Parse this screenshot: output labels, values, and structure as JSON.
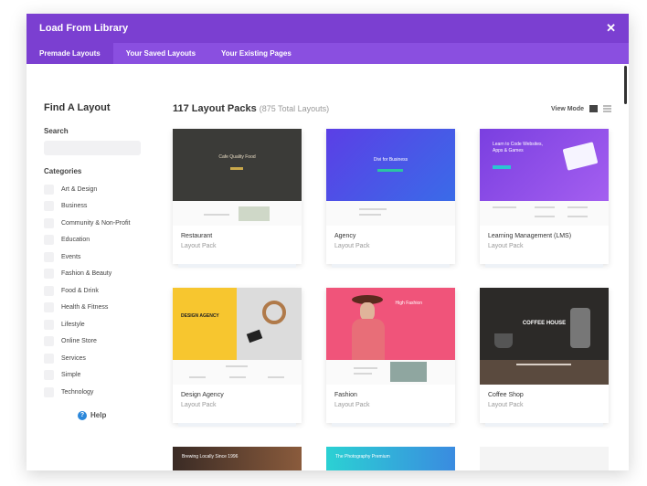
{
  "modal": {
    "title": "Load From Library",
    "close_label": "✕"
  },
  "tabs": [
    {
      "label": "Premade Layouts",
      "active": true
    },
    {
      "label": "Your Saved Layouts",
      "active": false
    },
    {
      "label": "Your Existing Pages",
      "active": false
    }
  ],
  "sidebar": {
    "title": "Find A Layout",
    "search_label": "Search",
    "search_value": "",
    "categories_label": "Categories",
    "categories": [
      "Art & Design",
      "Business",
      "Community & Non-Profit",
      "Education",
      "Events",
      "Fashion & Beauty",
      "Food & Drink",
      "Health & Fitness",
      "Lifestyle",
      "Online Store",
      "Services",
      "Simple",
      "Technology"
    ],
    "help_label": "Help"
  },
  "main": {
    "count_label": "117 Layout Packs",
    "total_label": "(875 Total Layouts)",
    "view_mode_label": "View Mode",
    "cards": [
      {
        "title": "Restaurant",
        "subtitle": "Layout Pack",
        "thumb_text": "Cafe Quality Food"
      },
      {
        "title": "Agency",
        "subtitle": "Layout Pack",
        "thumb_text": "Divi for Business"
      },
      {
        "title": "Learning Management (LMS)",
        "subtitle": "Layout Pack",
        "thumb_text": "Learn to Code Websites, Apps & Games"
      },
      {
        "title": "Design Agency",
        "subtitle": "Layout Pack",
        "thumb_text": "DESIGN AGENCY"
      },
      {
        "title": "Fashion",
        "subtitle": "Layout Pack",
        "thumb_text": "High Fashion"
      },
      {
        "title": "Coffee Shop",
        "subtitle": "Layout Pack",
        "thumb_text": "COFFEE HOUSE"
      }
    ],
    "partial_cards": [
      {
        "thumb_text": "Brewing Locally Since 1996"
      },
      {
        "thumb_text": "The Photography Premium"
      },
      {
        "thumb_text": ""
      }
    ]
  },
  "colors": {
    "title_bar": "#7b3fd1",
    "tab_bar": "#8a4fe0",
    "help_icon": "#2b87da"
  }
}
